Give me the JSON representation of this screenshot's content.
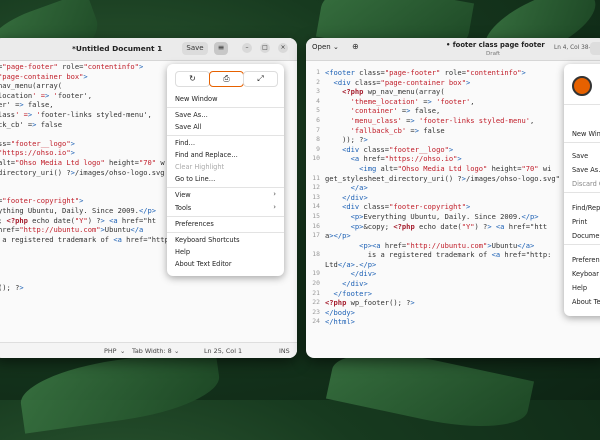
{
  "left_window": {
    "title": "*Untitled Document 1",
    "save_label": "Save",
    "status": {
      "language": "PHP",
      "tab_width": "Tab Width: 8",
      "position": "Ln 25, Col 1",
      "mode": "INS"
    },
    "code_lines": [
      "=\"page-footer\" role=\"contentinfo\">",
      "\"page-container box\">",
      "nav_menu(array(",
      "location' => 'footer',",
      "er' => false,",
      "lass' => 'footer-links styled-menu',",
      "ck_cb' => false",
      "",
      "ss=\"footer__logo\">",
      "\"https://ohso.io\">",
      "alt=\"Ohso Media Ltd logo\" height=\"70\" w",
      "directory_uri() ?>/images/ohso-logo.svg",
      "",
      "",
      "=\"footer-copyright\">",
      "ything Ubuntu, Daily. Since 2009.</p>",
      "; <?php echo date(\"Y\") ?> <a href=\"ht",
      "href=\"http://ubuntu.com\">Ubuntu</a",
      " a registered trademark of <a href=\"http",
      "",
      "",
      "",
      "",
      "(); ?>"
    ]
  },
  "menu": {
    "new_window": "New Window",
    "save_as": "Save As…",
    "save_all": "Save All",
    "find": "Find…",
    "find_replace": "Find and Replace…",
    "clear_highlight": "Clear Highlight",
    "go_to_line": "Go to Line…",
    "view": "View",
    "tools": "Tools",
    "preferences": "Preferences",
    "keyboard_shortcuts": "Keyboard Shortcuts",
    "help": "Help",
    "about": "About Text Editor"
  },
  "right_window": {
    "open_label": "Open",
    "title": "• footer class page footer",
    "subtitle": "Draft",
    "position": "Ln 4, Col 38",
    "line_numbers": [
      "1",
      "2",
      "3",
      "4",
      "5",
      "6",
      "7",
      "8",
      "9",
      "10",
      "",
      "11",
      "12",
      "13",
      "14",
      "15",
      "16",
      "17",
      "",
      "18",
      "",
      "19",
      "20",
      "21",
      "22",
      "23",
      "24"
    ],
    "code_lines": [
      "<footer class=\"page-footer\" role=\"contentinfo\">",
      "  <div class=\"page-container box\">",
      "    <?php wp_nav_menu(array(",
      "      'theme_location' => 'footer',",
      "      'container' => false,",
      "      'menu_class' => 'footer-links styled-menu',",
      "      'fallback_cb' => false",
      "    )); ?>",
      "    <div class=\"footer__logo\">",
      "      <a href=\"https://ohso.io\">",
      "        <img alt=\"Ohso Media Ltd logo\" height=\"70\" wi",
      "get_stylesheet_directory_uri() ?>/images/ohso-logo.svg\"",
      "      </a>",
      "    </div>",
      "    <div class=\"footer-copyright\">",
      "      <p>Everything Ubuntu, Daily. Since 2009.</p>",
      "      <p>&copy; <?php echo date(\"Y\") ?> <a href=\"htt",
      "a></p>",
      "        <p><a href=\"http://ubuntu.com\">Ubuntu</a>",
      "          is a registered trademark of <a href=\"http:",
      "Ltd</a>.</p>",
      "      </div>",
      "    </div>",
      "  </footer>",
      "<?php wp_footer(); ?>",
      "</body>",
      "</html>"
    ]
  },
  "right_menu": {
    "new_window": "New Win",
    "save": "Save",
    "save_as": "Save As…",
    "discard": "Discard C",
    "find_replace": "Find/Rep",
    "print": "Print",
    "document": "Documen",
    "preferences": "Preferen",
    "keyboard": "Keyboar",
    "help": "Help",
    "about": "About Te"
  }
}
